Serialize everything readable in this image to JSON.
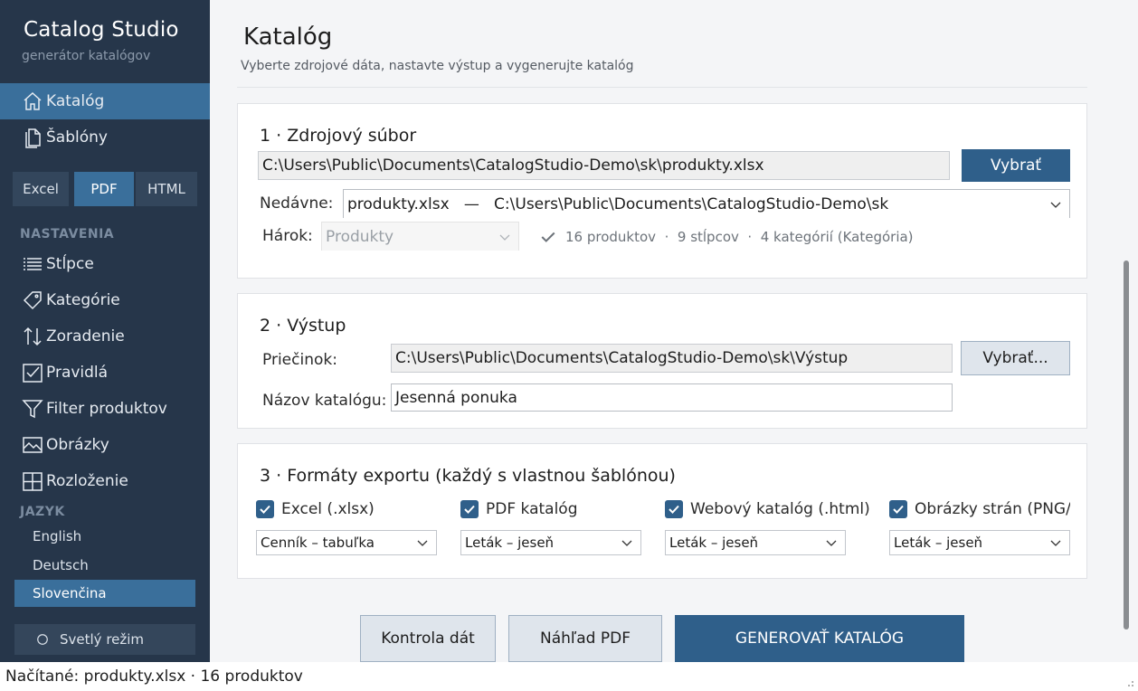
{
  "app": {
    "title": "Catalog Studio",
    "subtitle": "generátor katalógov"
  },
  "nav": {
    "main": [
      {
        "label": "Katalóg",
        "icon": "home-icon",
        "active": true
      },
      {
        "label": "Šablóny",
        "icon": "copy-icon",
        "active": false
      }
    ],
    "segments": [
      {
        "label": "Excel",
        "active": false
      },
      {
        "label": "PDF",
        "active": true
      },
      {
        "label": "HTML",
        "active": false
      }
    ],
    "settings_label": "NASTAVENIA",
    "settings": [
      {
        "label": "Stĺpce",
        "icon": "list-icon"
      },
      {
        "label": "Kategórie",
        "icon": "tag-icon"
      },
      {
        "label": "Zoradenie",
        "icon": "sort-icon"
      },
      {
        "label": "Pravidlá",
        "icon": "checkbox-icon"
      },
      {
        "label": "Filter produktov",
        "icon": "filter-icon"
      },
      {
        "label": "Obrázky",
        "icon": "image-icon"
      },
      {
        "label": "Rozloženie",
        "icon": "grid-icon"
      }
    ],
    "language_label": "JAZYK",
    "languages": [
      {
        "label": "English",
        "active": false
      },
      {
        "label": "Deutsch",
        "active": false
      },
      {
        "label": "Slovenčina",
        "active": true
      }
    ],
    "theme_button": "Svetlý režim"
  },
  "header": {
    "title": "Katalóg",
    "subtitle": "Vyberte zdrojové dáta, nastavte výstup a vygenerujte katalóg"
  },
  "source": {
    "title": "1 · Zdrojový súbor",
    "file_path": "C:\\Users\\Public\\Documents\\CatalogStudio-Demo\\sk\\produkty.xlsx",
    "choose_button": "Vybrať",
    "recent_label": "Nedávne:",
    "recent_value": "produkty.xlsx   —   C:\\Users\\Public\\Documents\\CatalogStudio-Demo\\sk",
    "sheet_label": "Hárok:",
    "sheet_value": "Produkty",
    "info": "16 produktov  ·  9 stĺpcov  ·  4 kategórií (Kategória)"
  },
  "output": {
    "title": "2 · Výstup",
    "folder_label": "Priečinok:",
    "folder_value": "C:\\Users\\Public\\Documents\\CatalogStudio-Demo\\sk\\Výstup",
    "choose_button": "Vybrať...",
    "name_label": "Názov katalógu:",
    "name_value": "Jesenná ponuka"
  },
  "formats": {
    "title": "3 · Formáty exportu (každý s vlastnou šablónou)",
    "items": [
      {
        "label": "Excel (.xlsx)",
        "checked": true,
        "template": "Cenník – tabuľka"
      },
      {
        "label": "PDF katalóg",
        "checked": true,
        "template": "Leták – jeseň"
      },
      {
        "label": "Webový katalóg (.html)",
        "checked": true,
        "template": "Leták – jeseň"
      },
      {
        "label": "Obrázky strán (PNG/JPG)",
        "checked": true,
        "template": "Leták – jeseň"
      }
    ]
  },
  "actions": {
    "check": "Kontrola dát",
    "preview": "Náhľad PDF",
    "generate": "GENEROVAŤ KATALÓG"
  },
  "status": {
    "text": "Načítané: produkty.xlsx · 16 produktov"
  },
  "colors": {
    "sidebar": "#26364a",
    "accent": "#3a6f9b",
    "primary_button": "#2f5f8a"
  }
}
